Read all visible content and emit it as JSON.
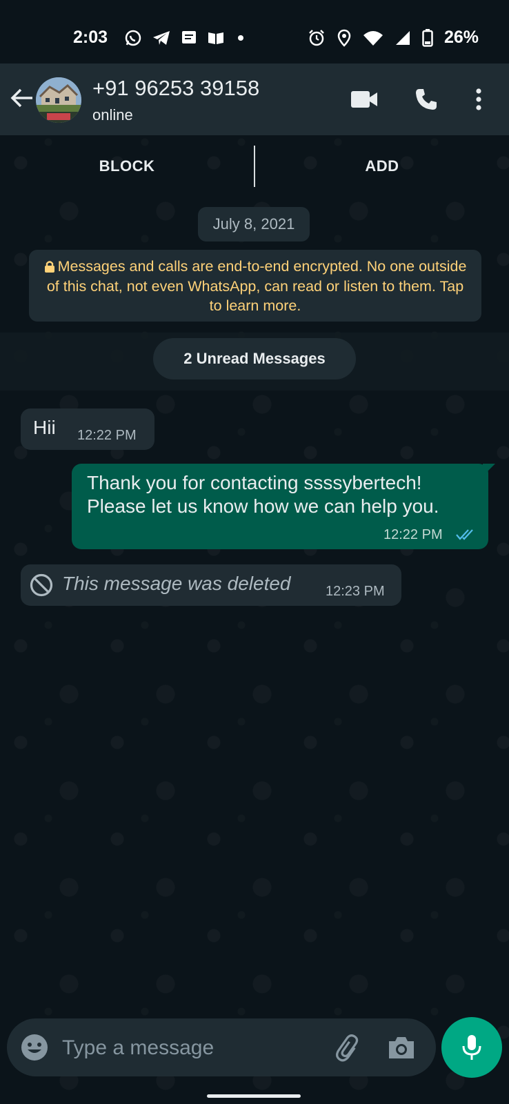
{
  "status_bar": {
    "time": "2:03",
    "battery": "26%",
    "left_icons": [
      "whatsapp-icon",
      "telegram-icon",
      "message-icon",
      "book-icon",
      "dot-icon"
    ],
    "right_icons": [
      "alarm-icon",
      "location-icon",
      "wifi-icon",
      "signal-icon",
      "battery-icon"
    ]
  },
  "header": {
    "contact_name": "+91 96253 39158",
    "status": "online"
  },
  "actions": {
    "block": "BLOCK",
    "add": "ADD"
  },
  "chat": {
    "date_chip": "July 8, 2021",
    "encryption_notice": "Messages and calls are end-to-end encrypted. No one outside of this chat, not even WhatsApp, can read or listen to them. Tap to learn more.",
    "unread_label": "2 Unread Messages",
    "messages": [
      {
        "direction": "in",
        "text": "Hii",
        "time": "12:22 PM"
      },
      {
        "direction": "out",
        "text_line1": "Thank you for contacting ssssybertech!",
        "text_line2": "Please let us know how we can help you.",
        "time": "12:22 PM",
        "read": true
      },
      {
        "direction": "in",
        "deleted": true,
        "text": "This message was deleted",
        "time": "12:23 PM"
      }
    ]
  },
  "composer": {
    "placeholder": "Type a message"
  },
  "colors": {
    "background": "#0b141a",
    "header": "#1f2c33",
    "incoming_bubble": "#202c33",
    "outgoing_bubble": "#005c4b",
    "accent": "#00a884",
    "notice_text": "#ffd279",
    "read_ticks": "#53bdeb"
  }
}
